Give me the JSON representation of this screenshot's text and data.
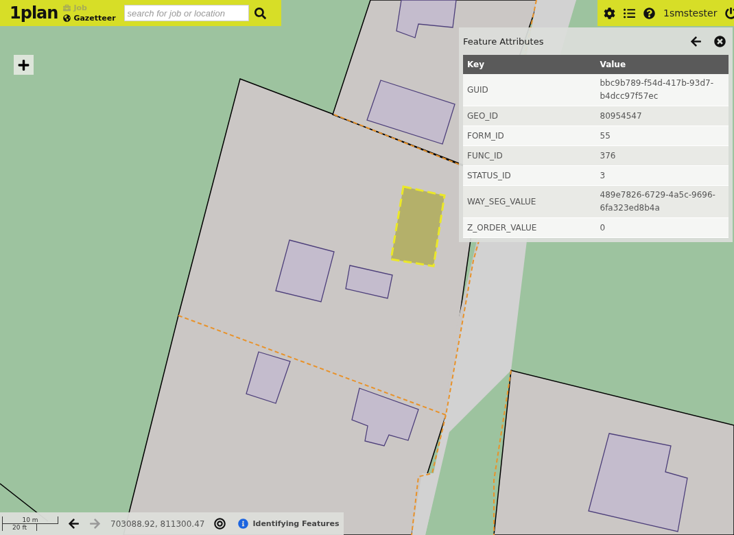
{
  "header": {
    "logo": "1plan",
    "nav": [
      {
        "label": "Job",
        "disabled": true
      },
      {
        "label": "Gazetteer",
        "disabled": false
      }
    ],
    "search": {
      "placeholder": "search for job or location"
    },
    "user": "1smstester"
  },
  "panel": {
    "title": "Feature Attributes",
    "columns": [
      "Key",
      "Value"
    ],
    "rows": [
      {
        "key": "GUID",
        "value": "bbc9b789-f54d-417b-93d7-b4dcc97f57ec"
      },
      {
        "key": "GEO_ID",
        "value": "80954547"
      },
      {
        "key": "FORM_ID",
        "value": "55"
      },
      {
        "key": "FUNC_ID",
        "value": "376"
      },
      {
        "key": "STATUS_ID",
        "value": "3"
      },
      {
        "key": "WAY_SEG_VALUE",
        "value": "489e7826-6729-4a5c-9696-6fa323ed8b4a"
      },
      {
        "key": "Z_ORDER_VALUE",
        "value": "0"
      }
    ]
  },
  "status_bar": {
    "scale_metric": "10 m",
    "scale_imperial": "20 ft",
    "back_disabled": false,
    "forward_disabled": true,
    "coordinates": "703088.92, 811300.47",
    "status": "Identifying Features"
  }
}
